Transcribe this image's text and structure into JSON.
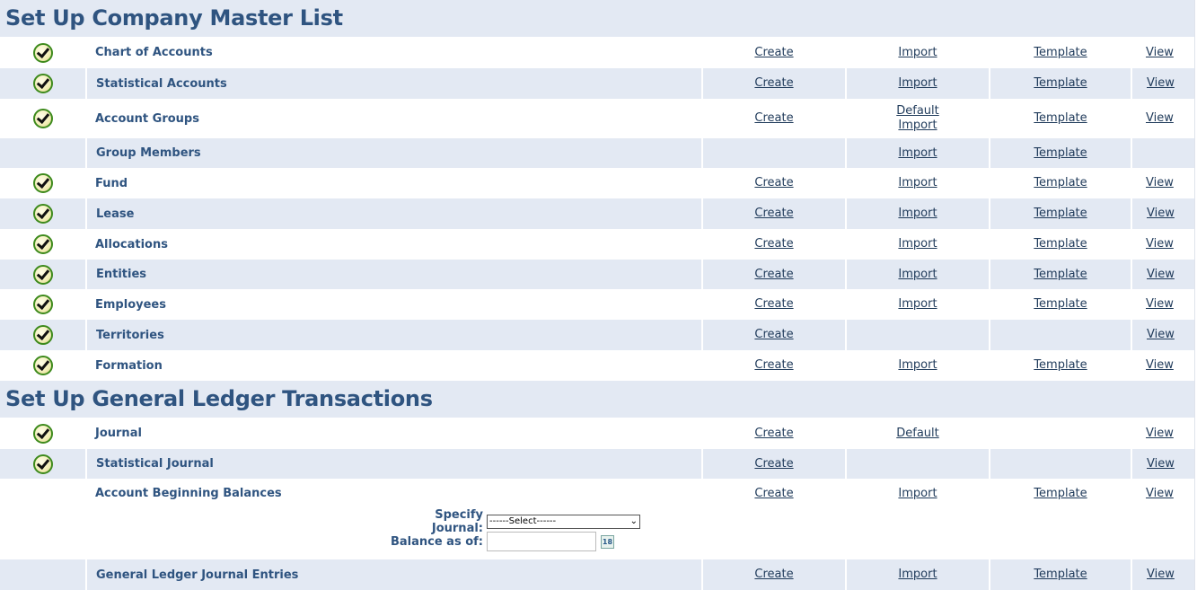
{
  "sections": [
    {
      "title": "Set Up Company Master List",
      "rows": [
        {
          "name": "Chart of Accounts",
          "checked": true,
          "create": "Create",
          "import": "Import",
          "template": "Template",
          "view": "View"
        },
        {
          "name": "Statistical Accounts",
          "checked": true,
          "create": "Create",
          "import": "Import",
          "template": "Template",
          "view": "View"
        },
        {
          "name": "Account Groups",
          "checked": true,
          "create": "Create",
          "import_default": "Default",
          "import": "Import",
          "template": "Template",
          "view": "View"
        },
        {
          "name": "Group Members",
          "checked": false,
          "import": "Import",
          "template": "Template"
        },
        {
          "name": "Fund",
          "checked": true,
          "create": "Create",
          "import": "Import",
          "template": "Template",
          "view": "View"
        },
        {
          "name": "Lease",
          "checked": true,
          "create": "Create",
          "import": "Import",
          "template": "Template",
          "view": "View"
        },
        {
          "name": "Allocations",
          "checked": true,
          "create": "Create",
          "import": "Import",
          "template": "Template",
          "view": "View"
        },
        {
          "name": "Entities",
          "checked": true,
          "create": "Create",
          "import": "Import",
          "template": "Template",
          "view": "View"
        },
        {
          "name": "Employees",
          "checked": true,
          "create": "Create",
          "import": "Import",
          "template": "Template",
          "view": "View"
        },
        {
          "name": "Territories",
          "checked": true,
          "create": "Create",
          "view": "View"
        },
        {
          "name": "Formation",
          "checked": true,
          "create": "Create",
          "import": "Import",
          "template": "Template",
          "view": "View"
        }
      ]
    },
    {
      "title": "Set Up General Ledger Transactions",
      "rows": [
        {
          "name": "Journal",
          "checked": true,
          "create": "Create",
          "import": "Default",
          "view": "View"
        },
        {
          "name": "Statistical Journal",
          "checked": true,
          "create": "Create",
          "view": "View"
        },
        {
          "name": "Account Beginning Balances",
          "checked": false,
          "create": "Create",
          "import": "Import",
          "template": "Template",
          "view": "View"
        },
        {
          "name": "General Ledger Journal Entries",
          "checked": false,
          "create": "Create",
          "import": "Import",
          "template": "Template",
          "view": "View"
        }
      ]
    }
  ],
  "balance_form": {
    "journal_label": "Specify Journal:",
    "journal_selected": "------Select------",
    "balance_label": "Balance as of:",
    "balance_value": "",
    "calendar_icon_text": "18"
  },
  "icons": {
    "check": "check-circle-icon",
    "calendar": "calendar-icon",
    "dropdown": "chevron-down-icon"
  }
}
